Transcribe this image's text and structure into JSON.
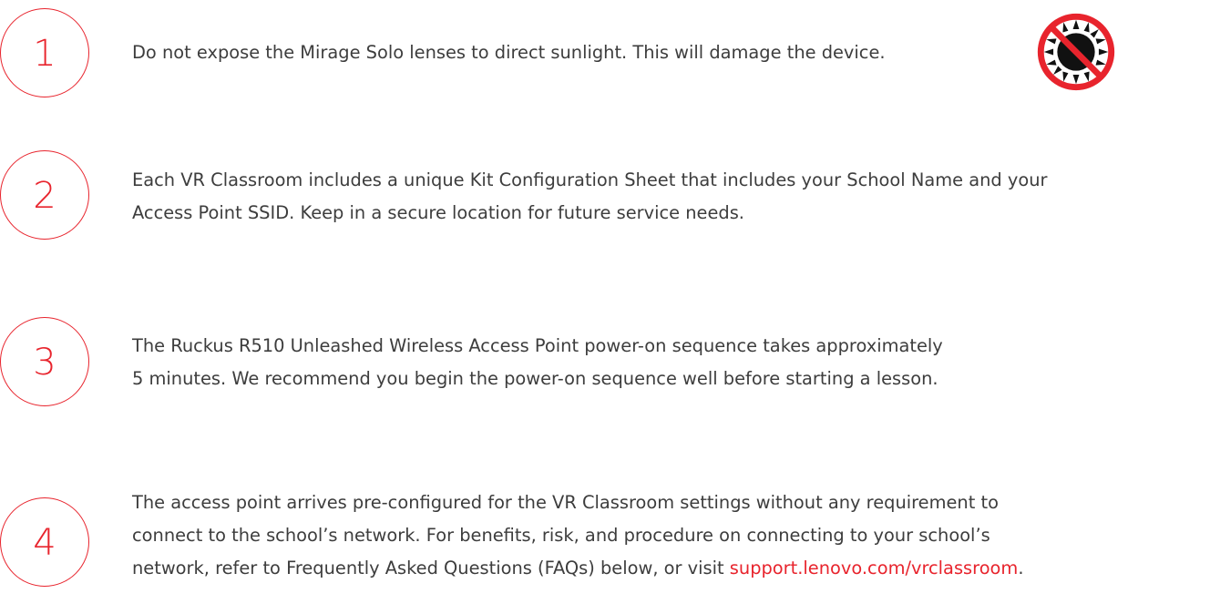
{
  "items": [
    {
      "number": "1",
      "lines": [
        "Do not expose the Mirage Solo lenses to direct sunlight. This will damage the device."
      ]
    },
    {
      "number": "2",
      "lines": [
        "Each VR Classroom includes a unique Kit Configuration Sheet that includes your School Name and your",
        "Access Point SSID. Keep in a secure location for future service needs."
      ]
    },
    {
      "number": "3",
      "lines": [
        "The Ruckus R510 Unleashed Wireless Access Point power-on sequence takes approximately",
        "5 minutes. We recommend you begin the power-on sequence well before starting a lesson."
      ]
    },
    {
      "number": "4",
      "lines": [
        "The access point arrives pre-configured for the VR Classroom settings without any requirement to",
        "connect to the school’s network. For benefits, risk, and procedure on connecting to your school’s"
      ],
      "last_line_prefix": "network, refer to Frequently Asked Questions (FAQs) below, or visit ",
      "link_text": "support.lenovo.com/vrclassroom",
      "last_line_suffix": "."
    }
  ],
  "icons": {
    "no_sunlight": "no-sunlight-icon"
  },
  "colors": {
    "accent": "#e8242d",
    "text": "#3d3d3d"
  }
}
